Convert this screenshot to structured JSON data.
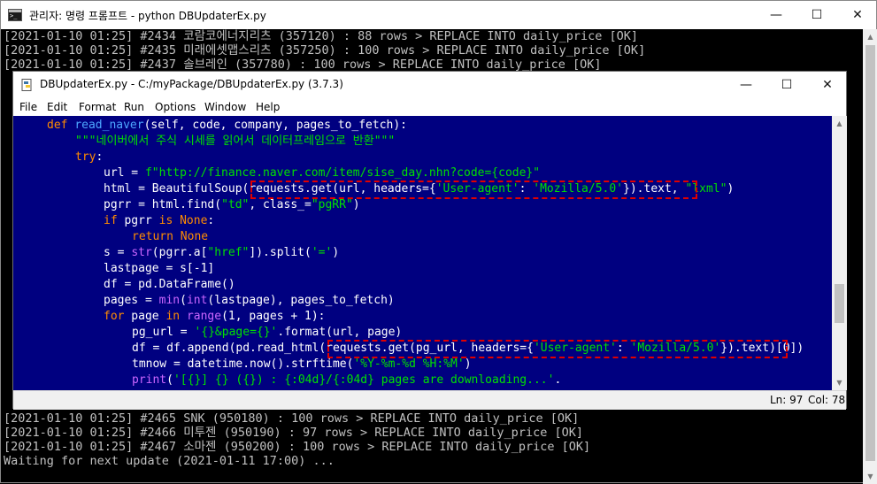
{
  "console": {
    "title": "관리자: 명령 프롬프트 - python  DBUpdaterEx.py",
    "lines_top": [
      "[2021-01-10 01:25] #2434 코람코에너지리츠 (357120) : 88 rows > REPLACE INTO daily_price [OK]",
      "[2021-01-10 01:25] #2435 미래에셋맵스리츠 (357250) : 100 rows > REPLACE INTO daily_price [OK]",
      "[2021-01-10 01:25] #2437 솔브레인 (357780) : 100 rows > REPLACE INTO daily_price [OK]"
    ],
    "lines_bottom": [
      "[2021-01-10 01:25] #2465 SNK (950180) : 100 rows > REPLACE INTO daily_price [OK]",
      "[2021-01-10 01:25] #2466 미투젠 (950190) : 97 rows > REPLACE INTO daily_price [OK]",
      "[2021-01-10 01:25] #2467 소마젠 (950200) : 100 rows > REPLACE INTO daily_price [OK]",
      "Waiting for next update (2021-01-11 17:00) ..."
    ],
    "hidden_left_brackets": [
      "[",
      "[",
      "[",
      "[",
      "[",
      "[",
      "[",
      "[",
      "[",
      "[",
      "[",
      "[",
      "[",
      "[",
      "["
    ],
    "buttons": {
      "minimize": "—",
      "maximize": "☐",
      "close": "✕"
    }
  },
  "idle": {
    "title": "DBUpdaterEx.py - C:/myPackage/DBUpdaterEx.py (3.7.3)",
    "menu": [
      "File",
      "Edit",
      "Format",
      "Run",
      "Options",
      "Window",
      "Help"
    ],
    "buttons": {
      "minimize": "—",
      "maximize": "☐",
      "close": "✕"
    },
    "status": {
      "ln": "Ln: 97",
      "col": "Col: 78"
    },
    "code": {
      "l1_def": "def",
      "l1_name": "read_naver",
      "l1_rest": "(self, code, company, pages_to_fetch):",
      "l2_doc": "\"\"\"네이버에서 주식 시세를 읽어서 데이터프레임으로 반환\"\"\"",
      "l3_try": "try",
      "l3_colon": ":",
      "l4_a": "url = ",
      "l4_str": "f\"http://finance.naver.com/item/sise_day.nhn?code={code}\"",
      "l5_a": "html = BeautifulSoup(requests.get(url, headers={",
      "l5_s1": "'User-agent'",
      "l5_b": ": ",
      "l5_s2": "'Mozilla/5.0'",
      "l5_c": "}).text, ",
      "l5_s3": "\"lxml\"",
      "l5_d": ")",
      "l6_a": "pgrr = html.find(",
      "l6_s1": "\"td\"",
      "l6_b": ", class_=",
      "l6_s2": "\"pgRR\"",
      "l6_c": ")",
      "l7_if": "if",
      "l7_a": " pgrr ",
      "l7_is": "is",
      "l7_sp": " ",
      "l7_none": "None",
      "l7_c": ":",
      "l8_ret": "return",
      "l8_sp": " ",
      "l8_none": "None",
      "l9_a": "s = ",
      "l9_str": "str",
      "l9_b": "(pgrr.a[",
      "l9_s1": "\"href\"",
      "l9_c": "]).split(",
      "l9_s2": "'='",
      "l9_d": ")",
      "l10": "lastpage = s[-1]",
      "l11": "df = pd.DataFrame()",
      "l12_a": "pages = ",
      "l12_min": "min",
      "l12_b": "(",
      "l12_int": "int",
      "l12_c": "(lastpage), pages_to_fetch)",
      "l13_for": "for",
      "l13_a": " page ",
      "l13_in": "in",
      "l13_sp": " ",
      "l13_range": "range",
      "l13_b": "(1, pages + 1):",
      "l14_a": "pg_url = ",
      "l14_s": "'{}&page={}'",
      "l14_b": ".format(url, page)",
      "l15_a": "df = df.append(pd.read_html(requests.get(pg_url, headers={",
      "l15_s1": "'User-agent'",
      "l15_b": ": ",
      "l15_s2": "'Mozilla/5.0'",
      "l15_c": "}).text)[0])",
      "l16_a": "tmnow = datetime.now().strftime(",
      "l16_s": "'%Y-%m-%d %H:%M'",
      "l16_b": ")",
      "l17_print": "print",
      "l17_a": "(",
      "l17_s": "'[{}] {} ({}) : {:04d}/{:04d} pages are downloading...'",
      "l17_b": "."
    }
  }
}
